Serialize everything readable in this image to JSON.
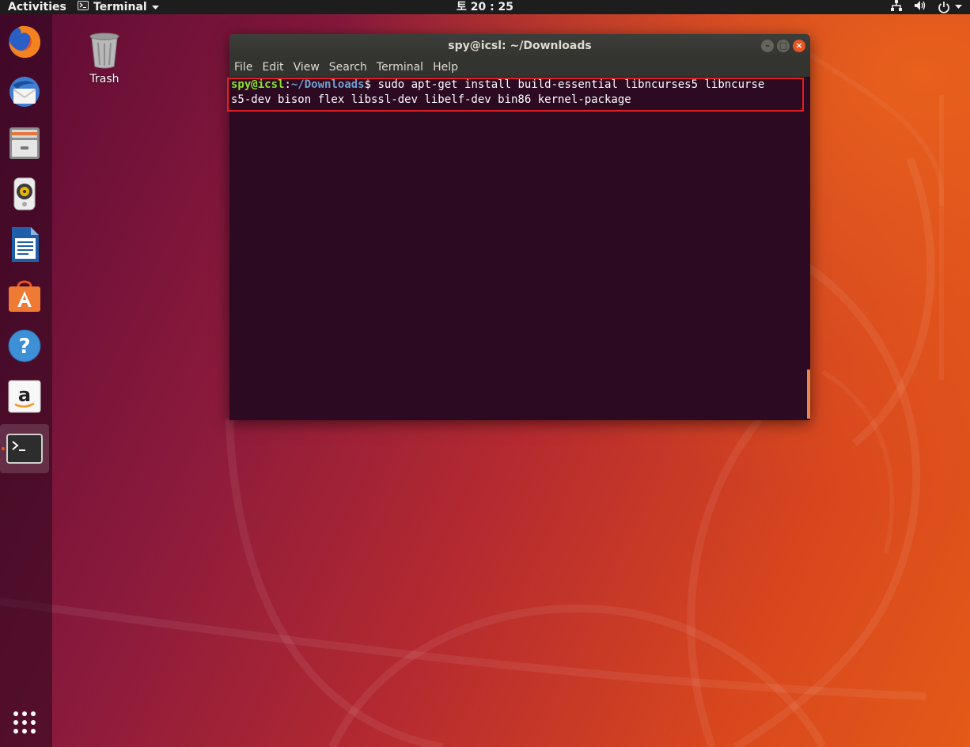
{
  "topbar": {
    "activities": "Activities",
    "app_menu_label": "Terminal",
    "clock": "토 20 : 25",
    "tray_icons": [
      "network-icon",
      "volume-icon",
      "power-icon"
    ]
  },
  "dock": {
    "items": [
      "firefox",
      "thunderbird",
      "files",
      "rhythmbox",
      "libreoffice-writer",
      "ubuntu-software",
      "help",
      "amazon",
      "terminal"
    ],
    "active_item": "terminal",
    "show_apps": "show-applications"
  },
  "desktop": {
    "trash_label": "Trash"
  },
  "terminal": {
    "title": "spy@icsl: ~/Downloads",
    "menu": [
      "File",
      "Edit",
      "View",
      "Search",
      "Terminal",
      "Help"
    ],
    "prompt_user": "spy@icsl",
    "prompt_colon": ":",
    "prompt_path": "~/Downloads",
    "prompt_symbol": "$",
    "command_line1": " sudo apt-get install build-essential libncurses5 libncurse",
    "command_line2": "s5-dev bison flex libssl-dev libelf-dev bin86 kernel-package"
  },
  "colors": {
    "accent": "#e95420",
    "terminal_bg": "#2c0a22",
    "prompt_user": "#8ae234",
    "prompt_path": "#729fcf",
    "highlight_box": "#e02020"
  }
}
